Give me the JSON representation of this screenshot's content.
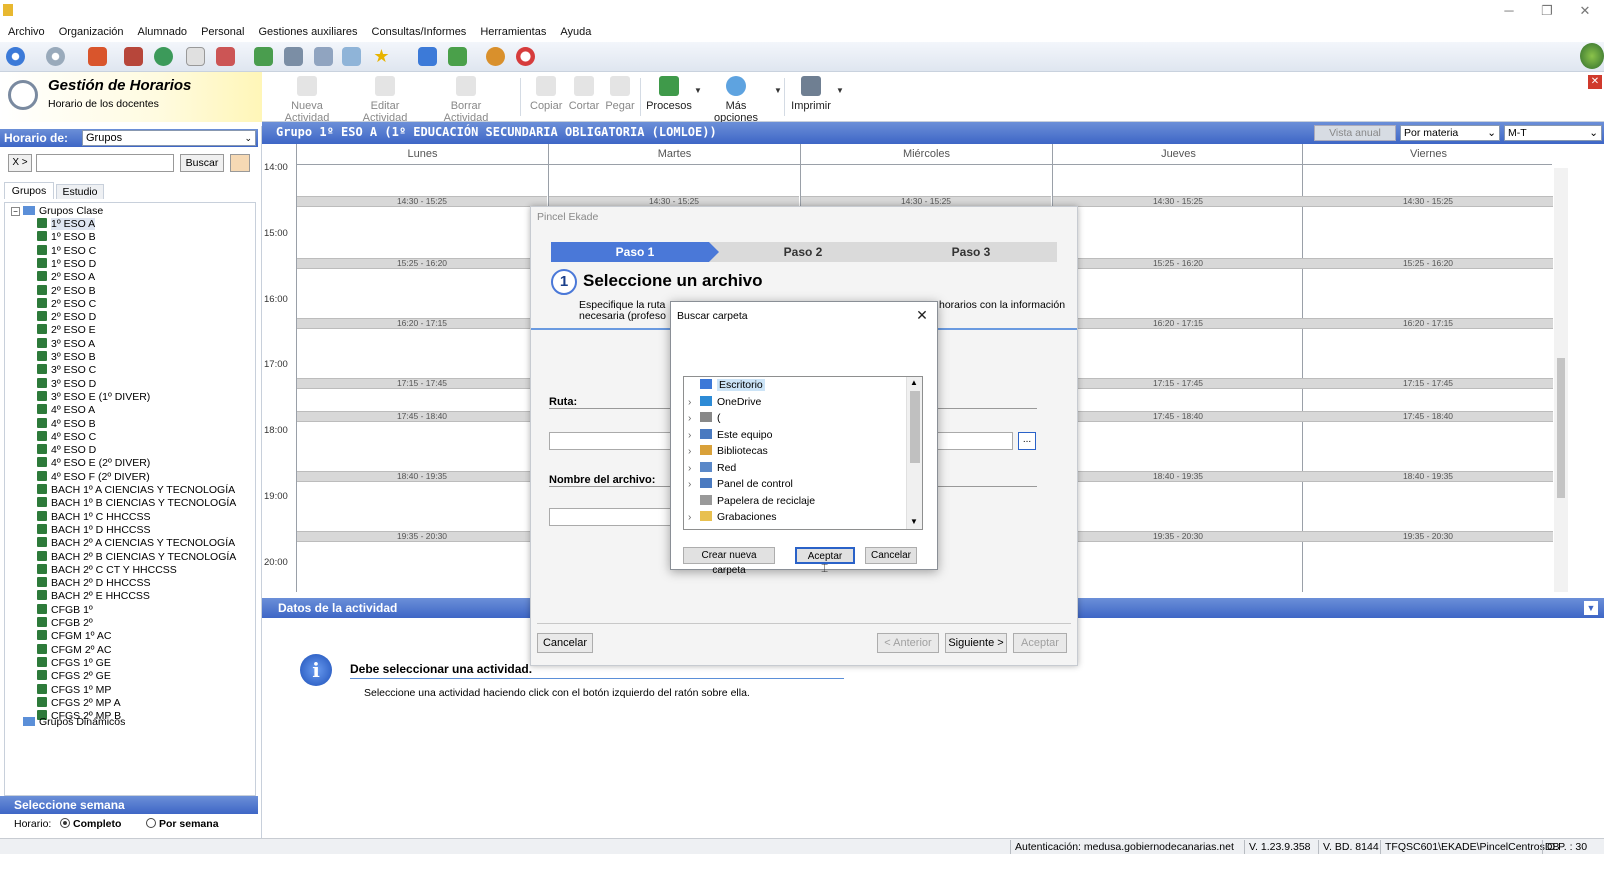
{
  "menu": [
    "Archivo",
    "Organización",
    "Alumnado",
    "Personal",
    "Gestiones auxiliares",
    "Consultas/Informes",
    "Herramientas",
    "Ayuda"
  ],
  "module": {
    "title": "Gestión de Horarios",
    "subtitle": "Horario de los docentes"
  },
  "ribbon": {
    "nueva": "Nueva Actividad",
    "editar": "Editar Actividad",
    "borrar": "Borrar Actividad",
    "copiar": "Copiar",
    "cortar": "Cortar",
    "pegar": "Pegar",
    "procesos": "Procesos",
    "mas": "Más opciones",
    "imprimir": "Imprimir"
  },
  "left": {
    "horario_label": "Horario de:",
    "horario_value": "Grupos",
    "xbtn": "X >",
    "search_placeholder": "",
    "buscar": "Buscar",
    "tab_grupos": "Grupos",
    "tab_estudio": "Estudio",
    "root": "Grupos Clase",
    "groups": [
      "1º ESO A",
      "1º ESO B",
      "1º ESO C",
      "1º ESO D",
      "2º ESO A",
      "2º ESO B",
      "2º ESO C",
      "2º ESO D",
      "2º ESO E",
      "3º ESO A",
      "3º ESO B",
      "3º ESO C",
      "3º ESO D",
      "3º ESO E (1º DIVER)",
      "4º ESO A",
      "4º ESO B",
      "4º ESO C",
      "4º ESO D",
      "4º ESO E (2º DIVER)",
      "4º ESO F (2º DIVER)",
      "BACH 1º A CIENCIAS Y TECNOLOGÍA",
      "BACH 1º B CIENCIAS Y TECNOLOGÍA",
      "BACH 1º C HHCCSS",
      "BACH 1º D HHCCSS",
      "BACH 2º A CIENCIAS Y TECNOLOGÍA",
      "BACH 2º B CIENCIAS Y TECNOLOGÍA",
      "BACH 2º C CT Y HHCCSS",
      "BACH 2º D HHCCSS",
      "BACH 2º E HHCCSS",
      "CFGB 1º",
      "CFGB 2º",
      "CFGM 1º AC",
      "CFGM 2º AC",
      "CFGS 1º GE",
      "CFGS 2º GE",
      "CFGS 1º MP",
      "CFGS 2º MP A",
      "CFGS 2º MP B"
    ],
    "root2": "Grupos Dinámicos",
    "semana_title": "Seleccione semana",
    "horario2": "Horario:",
    "completo": "Completo",
    "porsemana": "Por semana"
  },
  "schedule": {
    "title": "Grupo 1º ESO A (1º EDUCACIÓN SECUNDARIA OBLIGATORIA (LOMLOE))",
    "vista": "Vista anual",
    "filter1": "Por materia",
    "filter2": "M-T",
    "days": [
      "Lunes",
      "Martes",
      "Miércoles",
      "Jueves",
      "Viernes"
    ],
    "hours": [
      "14:00",
      "15:00",
      "16:00",
      "17:00",
      "18:00",
      "19:00",
      "20:00"
    ],
    "slots": [
      "14:30 - 15:25",
      "15:25 - 16:20",
      "16:20 - 17:15",
      "17:15 - 17:45",
      "17:45 - 18:40",
      "18:40 - 19:35",
      "19:35 - 20:30"
    ]
  },
  "datos": {
    "title": "Datos de la actividad",
    "msg_title": "Debe seleccionar una actividad.",
    "msg_body": "Seleccione una actividad haciendo click con el botón izquierdo del ratón sobre ella."
  },
  "wizard": {
    "title": "Pincel Ekade",
    "paso1": "Paso 1",
    "paso2": "Paso 2",
    "paso3": "Paso 3",
    "step_num": "1",
    "heading": "Seleccione un archivo",
    "desc_left1": "Especifique la ruta",
    "desc_left2": "necesaria (profeso",
    "desc_right": "horarios con la información",
    "ruta": "Ruta:",
    "nombre": "Nombre del archivo:",
    "browse": "...",
    "cancelar": "Cancelar",
    "anterior": "< Anterior",
    "siguiente": "Siguiente >",
    "aceptar": "Aceptar"
  },
  "folder": {
    "title": "Buscar carpeta",
    "items": [
      "Escritorio",
      "OneDrive",
      "(",
      "Este equipo",
      "Bibliotecas",
      "Red",
      "Panel de control",
      "Papelera de reciclaje",
      "Grabaciones"
    ],
    "crear": "Crear nueva carpeta",
    "aceptar": "Aceptar",
    "cancelar": "Cancelar"
  },
  "status": {
    "auth": "Autenticación: medusa.gobiernodecanarias.net",
    "version": "V. 1.23.9.358",
    "bd": "V. BD. 8144",
    "db": "TFQSC601\\EKADE\\PincelCentrosDB",
    "op": "O.P. : 30"
  }
}
